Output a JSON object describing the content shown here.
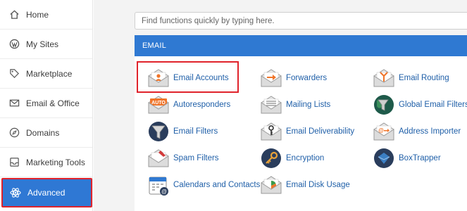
{
  "sidebar": {
    "items": [
      {
        "label": "Home",
        "icon": "home-icon"
      },
      {
        "label": "My Sites",
        "icon": "wordpress-icon"
      },
      {
        "label": "Marketplace",
        "icon": "tag-icon"
      },
      {
        "label": "Email & Office",
        "icon": "envelope-icon"
      },
      {
        "label": "Domains",
        "icon": "compass-icon"
      },
      {
        "label": "Marketing Tools",
        "icon": "inbox-tray-icon"
      },
      {
        "label": "Advanced",
        "icon": "atom-icon",
        "active": true
      }
    ]
  },
  "search": {
    "placeholder": "Find functions quickly by typing here."
  },
  "panel": {
    "title": "EMAIL",
    "functions": [
      {
        "label": "Email Accounts",
        "icon": "email-accounts-icon"
      },
      {
        "label": "Forwarders",
        "icon": "forwarders-icon"
      },
      {
        "label": "Email Routing",
        "icon": "email-routing-icon"
      },
      {
        "label": "Autoresponders",
        "icon": "autoresponders-icon",
        "badge": "AUTO"
      },
      {
        "label": "Mailing Lists",
        "icon": "mailing-lists-icon"
      },
      {
        "label": "Global Email Filters",
        "icon": "global-email-filters-icon"
      },
      {
        "label": "Email Filters",
        "icon": "email-filters-icon"
      },
      {
        "label": "Email Deliverability",
        "icon": "email-deliverability-icon"
      },
      {
        "label": "Address Importer",
        "icon": "address-importer-icon"
      },
      {
        "label": "Spam Filters",
        "icon": "spam-filters-icon"
      },
      {
        "label": "Encryption",
        "icon": "encryption-icon"
      },
      {
        "label": "BoxTrapper",
        "icon": "boxtrapper-icon"
      },
      {
        "label": "Calendars and Contacts",
        "icon": "calendars-contacts-icon"
      },
      {
        "label": "Email Disk Usage",
        "icon": "email-disk-usage-icon"
      }
    ]
  },
  "colors": {
    "accent": "#2f78d4",
    "highlight": "#e0232b",
    "link": "#1f5fa8",
    "orange": "#f0752a"
  }
}
